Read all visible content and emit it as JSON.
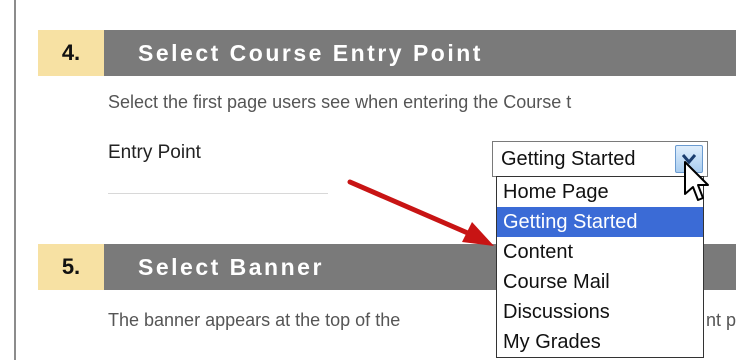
{
  "step4": {
    "number": "4.",
    "title": "Select Course Entry Point",
    "description": "Select the first page users see when entering the Course t"
  },
  "entry_point": {
    "label": "Entry Point",
    "selected_value": "Getting Started",
    "options": [
      "Home Page",
      "Getting Started",
      "Content",
      "Course Mail",
      "Discussions",
      "My Grades"
    ],
    "selected_index": 1
  },
  "step5": {
    "number": "5.",
    "title": "Select Banner",
    "description_start": "The banner appears at the top of the",
    "description_end": "nt p"
  },
  "colors": {
    "step_number_bg": "#f7e1a3",
    "step_bar_bg": "#7a7a7a",
    "selected_option_bg": "#3b6bd6",
    "annotation_arrow": "#c81414"
  },
  "icons": {
    "dropdown": "chevron-down-icon",
    "pointer": "mouse-pointer-icon",
    "annotation": "red-annotation-arrow"
  }
}
